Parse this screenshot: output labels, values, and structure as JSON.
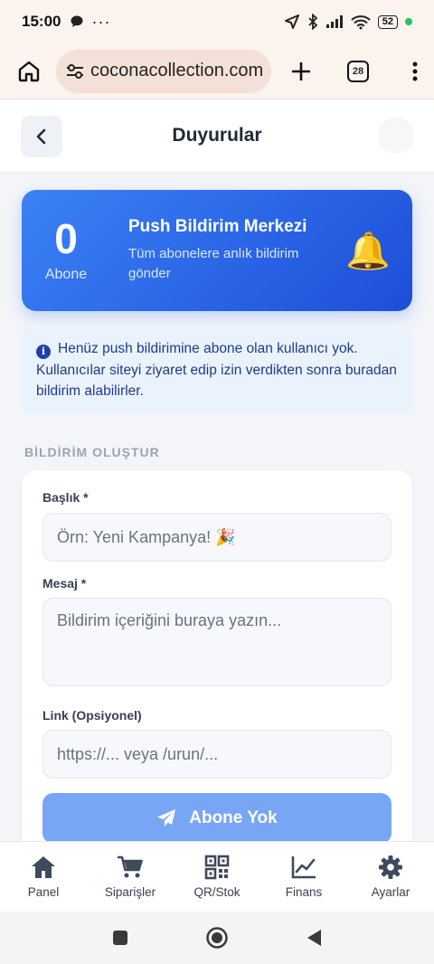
{
  "status_bar": {
    "time": "15:00",
    "battery": "52"
  },
  "browser": {
    "url": "coconacollection.com",
    "tab_count": "28"
  },
  "header": {
    "title": "Duyurular"
  },
  "hero": {
    "subscriber_count": "0",
    "subscriber_label": "Abone",
    "title": "Push Bildirim Merkezi",
    "subtitle": "Tüm abonelere anlık bildirim gönder"
  },
  "info": {
    "text": "Henüz push bildirimine abone olan kullanıcı yok. Kullanıcılar siteyi ziyaret edip izin verdikten sonra buradan bildirim alabilirler."
  },
  "form": {
    "section_label": "BİLDİRİM OLUŞTUR",
    "title_label": "Başlık *",
    "title_placeholder": "Örn: Yeni Kampanya! 🎉",
    "message_label": "Mesaj *",
    "message_placeholder": "Bildirim içeriğini buraya yazın...",
    "link_label": "Link (Opsiyonel)",
    "link_placeholder": "https://... veya /urun/...",
    "submit_label": "Abone Yok"
  },
  "bottom_nav": {
    "items": [
      {
        "label": "Panel",
        "icon": "home-icon"
      },
      {
        "label": "Siparişler",
        "icon": "cart-icon"
      },
      {
        "label": "QR/Stok",
        "icon": "qr-icon"
      },
      {
        "label": "Finans",
        "icon": "chart-line-icon"
      },
      {
        "label": "Ayarlar",
        "icon": "gear-icon"
      }
    ]
  },
  "colors": {
    "accent": "#2563eb",
    "hero_gradient_start": "#3b82f6",
    "hero_gradient_end": "#1d4ed8",
    "info_bg": "#eaf3fd",
    "disabled_button": "#78a6f4"
  }
}
